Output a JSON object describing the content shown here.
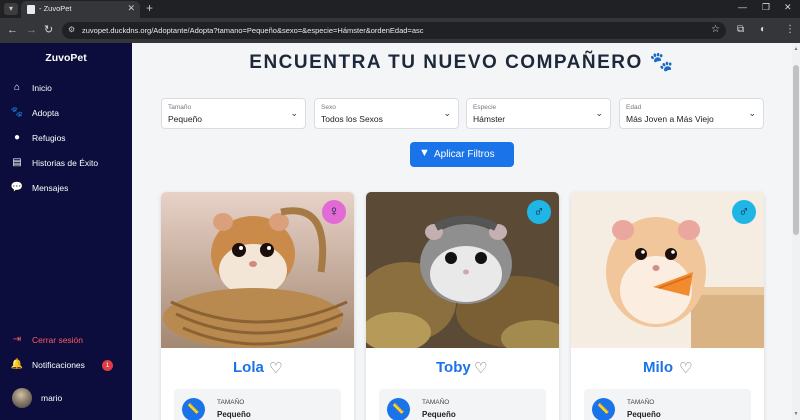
{
  "browser": {
    "tab_title": "- ZuvoPet",
    "url": "zuvopet.duckdns.org/Adoptante/Adopta?tamano=Pequeño&sexo=&especie=Hámster&ordenEdad=asc"
  },
  "sidebar": {
    "brand": "ZuvoPet",
    "items": [
      {
        "label": "Inicio",
        "icon": "home-icon"
      },
      {
        "label": "Adopta",
        "icon": "paw-icon"
      },
      {
        "label": "Refugios",
        "icon": "map-pin-icon"
      },
      {
        "label": "Historias de Éxito",
        "icon": "book-icon"
      },
      {
        "label": "Mensajes",
        "icon": "chat-icon"
      }
    ],
    "logout": "Cerrar sesión",
    "notifications": {
      "label": "Notificaciones",
      "count": "1"
    },
    "user": "mario"
  },
  "main": {
    "heading": "ENCUENTRA TU NUEVO COMPAÑERO 🐾",
    "filters": [
      {
        "label": "Tamaño",
        "value": "Pequeño"
      },
      {
        "label": "Sexo",
        "value": "Todos los Sexos"
      },
      {
        "label": "Especie",
        "value": "Hámster"
      },
      {
        "label": "Edad",
        "value": "Más Joven a Más Viejo"
      }
    ],
    "apply_button": "Aplicar Filtros",
    "pets": [
      {
        "name": "Lola",
        "gender": "female",
        "gender_symbol": "♀",
        "info_label": "TAMAÑO",
        "info_value": "Pequeño"
      },
      {
        "name": "Toby",
        "gender": "male",
        "gender_symbol": "♂",
        "info_label": "TAMAÑO",
        "info_value": "Pequeño"
      },
      {
        "name": "Milo",
        "gender": "male",
        "gender_symbol": "♂",
        "info_label": "TAMAÑO",
        "info_value": "Pequeño"
      }
    ]
  },
  "colors": {
    "sidebar_bg": "#0c0d3d",
    "accent_blue": "#1a73e8",
    "female_badge": "#e26ad4",
    "male_badge": "#1fb6e6",
    "logout_red": "#ff5a5f"
  }
}
